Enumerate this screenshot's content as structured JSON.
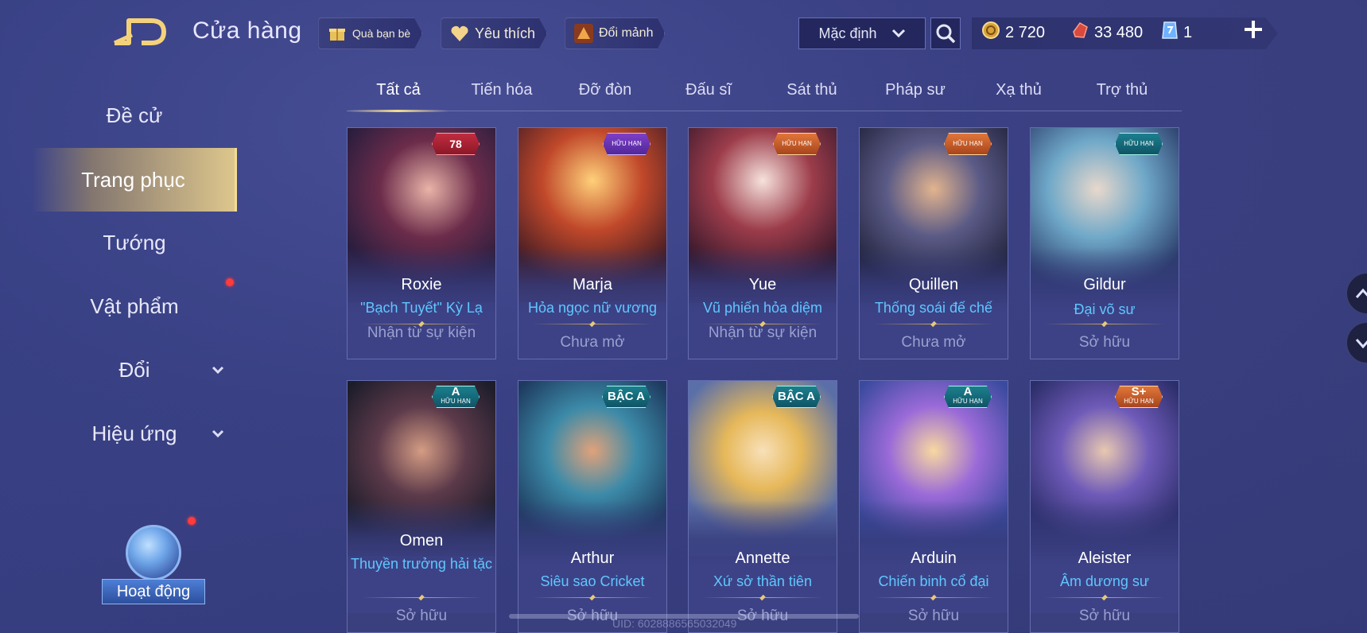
{
  "header": {
    "title": "Cửa hàng",
    "gift_label": "Quà bạn bè",
    "wishlist_label": "Yêu thích",
    "exchange_label": "Đổi mảnh",
    "sort_value": "Mặc định"
  },
  "currency": {
    "gold": "2 720",
    "vouchers": "33 480",
    "coupons": "1"
  },
  "sidebar": {
    "items": [
      {
        "label": "Đề cử"
      },
      {
        "label": "Trang phục"
      },
      {
        "label": "Tướng"
      },
      {
        "label": "Vật phẩm"
      },
      {
        "label": "Đổi"
      },
      {
        "label": "Hiệu ứng"
      }
    ],
    "event_label": "Hoạt động"
  },
  "tabs": [
    "Tất cả",
    "Tiến hóa",
    "Đỡ đòn",
    "Đấu sĩ",
    "Sát thủ",
    "Pháp sư",
    "Xạ thủ",
    "Trợ thủ"
  ],
  "cards": [
    {
      "hero": "Roxie",
      "skin": "\"Bạch Tuyết\" Kỳ Lạ",
      "status": "Nhận từ sự kiện",
      "badge": "78",
      "badge_sub": "",
      "badge_color": "#c22c3e"
    },
    {
      "hero": "Marja",
      "skin": "Hỏa ngọc nữ vương",
      "status": "Chưa mở",
      "badge": "",
      "badge_sub": "HỮU HẠN",
      "badge_color": "#7d3fc8"
    },
    {
      "hero": "Yue",
      "skin": "Vũ phiến hỏa diệm",
      "status": "Nhận từ sự kiện",
      "badge": "",
      "badge_sub": "HỮU HẠN",
      "badge_color": "#e0763a"
    },
    {
      "hero": "Quillen",
      "skin": "Thống soái đế chế",
      "status": "Chưa mở",
      "badge": "",
      "badge_sub": "HỮU HẠN",
      "badge_color": "#e0763a"
    },
    {
      "hero": "Gildur",
      "skin": "Đại võ sư",
      "status": "Sở hữu",
      "badge": "",
      "badge_sub": "HỮU HẠN",
      "badge_color": "#1c7f8e"
    },
    {
      "hero": "Omen",
      "skin": "Thuyền trưởng hải tặc",
      "status": "Sở hữu",
      "badge": "A",
      "badge_sub": "HỮU HẠN",
      "badge_color": "#1c7f8e"
    },
    {
      "hero": "Arthur",
      "skin": "Siêu sao Cricket",
      "status": "Sở hữu",
      "badge": "BẬC A",
      "badge_sub": "",
      "badge_color": "#1c7f8e"
    },
    {
      "hero": "Annette",
      "skin": "Xứ sở thần tiên",
      "status": "Sở hữu",
      "badge": "BẬC A",
      "badge_sub": "",
      "badge_color": "#1c7f8e"
    },
    {
      "hero": "Arduin",
      "skin": "Chiến binh cổ đại",
      "status": "Sở hữu",
      "badge": "A",
      "badge_sub": "HỮU HẠN",
      "badge_color": "#1c7f8e"
    },
    {
      "hero": "Aleister",
      "skin": "Âm dương sư",
      "status": "Sở hữu",
      "badge": "S+",
      "badge_sub": "HỮU HẠN",
      "badge_color": "#e0763a"
    }
  ],
  "footer": {
    "uid": "UID: 6028886565032049"
  }
}
